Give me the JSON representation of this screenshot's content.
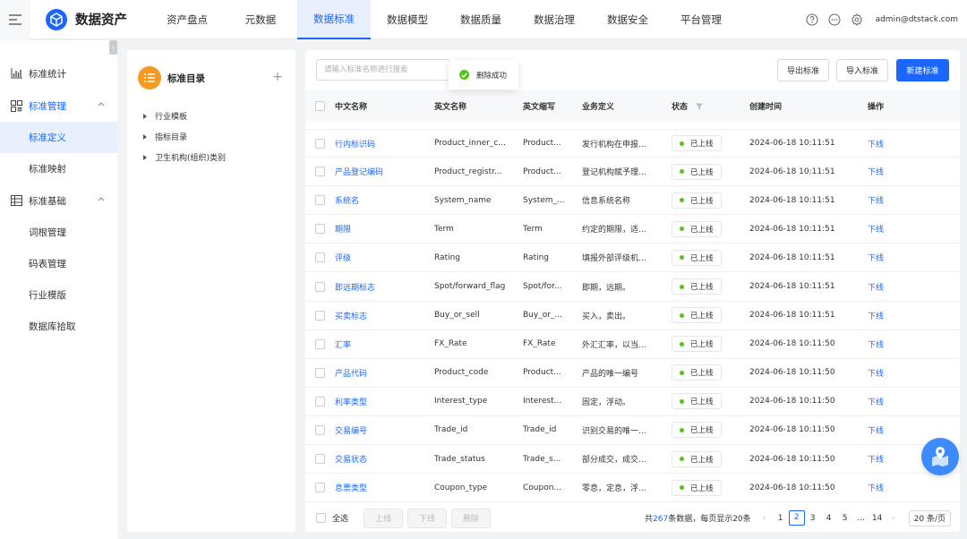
{
  "app": {
    "title": "数据资产"
  },
  "nav": {
    "items": [
      {
        "label": "资产盘点",
        "active": false
      },
      {
        "label": "元数据",
        "active": false
      },
      {
        "label": "数据标准",
        "active": true
      },
      {
        "label": "数据模型",
        "active": false
      },
      {
        "label": "数据质量",
        "active": false
      },
      {
        "label": "数据治理",
        "active": false
      },
      {
        "label": "数据安全",
        "active": false
      },
      {
        "label": "平台管理",
        "active": false
      }
    ],
    "user": "admin@dtstack.com",
    "icons": [
      "help-icon",
      "message-icon",
      "settings-icon"
    ]
  },
  "sidebar": {
    "groups": [
      {
        "label": "标准统计",
        "icon": "chart-icon",
        "items": []
      },
      {
        "label": "标准管理",
        "icon": "manage-icon",
        "open": true,
        "items": [
          {
            "label": "标准定义",
            "active": true
          },
          {
            "label": "标准映射",
            "active": false
          }
        ]
      },
      {
        "label": "标准基础",
        "icon": "table-icon",
        "open": true,
        "items": [
          {
            "label": "词根管理",
            "active": false
          },
          {
            "label": "码表管理",
            "active": false
          },
          {
            "label": "行业模版",
            "active": false
          },
          {
            "label": "数据库拾取",
            "active": false
          }
        ]
      }
    ]
  },
  "directory": {
    "title": "标准目录",
    "nodes": [
      "行业模板",
      "指标目录",
      "卫生机构(组织)类别"
    ]
  },
  "toolbar": {
    "search_placeholder": "请输入标准名称进行搜索",
    "export_label": "导出标准",
    "import_label": "导入标准",
    "new_label": "新建标准"
  },
  "toast": {
    "message": "删除成功"
  },
  "table": {
    "headers": {
      "cn": "中文名称",
      "en": "英文名称",
      "abbr": "英文缩写",
      "def": "业务定义",
      "status": "状态",
      "time": "创建时间",
      "op": "操作"
    },
    "rows": [
      {
        "cn": "行内标识码",
        "en": "Product_inner_c...",
        "abbr": "Product...",
        "def": "发行机构在申报...",
        "status": "已上线",
        "time": "2024-06-18 10:11:51",
        "op": "下线"
      },
      {
        "cn": "产品登记编码",
        "en": "Product_registr...",
        "abbr": "Product...",
        "def": "登记机构赋予理...",
        "status": "已上线",
        "time": "2024-06-18 10:11:51",
        "op": "下线"
      },
      {
        "cn": "系统名",
        "en": "System_name",
        "abbr": "System_...",
        "def": "信息系统名称",
        "status": "已上线",
        "time": "2024-06-18 10:11:51",
        "op": "下线"
      },
      {
        "cn": "期限",
        "en": "Term",
        "abbr": "Term",
        "def": "约定的期限，适...",
        "status": "已上线",
        "time": "2024-06-18 10:11:51",
        "op": "下线"
      },
      {
        "cn": "评级",
        "en": "Rating",
        "abbr": "Rating",
        "def": "填报外部评级机...",
        "status": "已上线",
        "time": "2024-06-18 10:11:51",
        "op": "下线"
      },
      {
        "cn": "即远期标志",
        "en": "Spot/forward_flag",
        "abbr": "Spot/for...",
        "def": "即期，远期。",
        "status": "已上线",
        "time": "2024-06-18 10:11:51",
        "op": "下线"
      },
      {
        "cn": "买卖标志",
        "en": "Buy_or_sell",
        "abbr": "Buy_or_...",
        "def": "买入，卖出。",
        "status": "已上线",
        "time": "2024-06-18 10:11:51",
        "op": "下线"
      },
      {
        "cn": "汇率",
        "en": "FX_Rate",
        "abbr": "FX_Rate",
        "def": "外汇汇率，以当...",
        "status": "已上线",
        "time": "2024-06-18 10:11:50",
        "op": "下线"
      },
      {
        "cn": "产品代码",
        "en": "Product_code",
        "abbr": "Product...",
        "def": "产品的唯一编号",
        "status": "已上线",
        "time": "2024-06-18 10:11:50",
        "op": "下线"
      },
      {
        "cn": "利率类型",
        "en": "Interest_type",
        "abbr": "Interest...",
        "def": "固定，浮动。",
        "status": "已上线",
        "time": "2024-06-18 10:11:50",
        "op": "下线"
      },
      {
        "cn": "交易编号",
        "en": "Trade_id",
        "abbr": "Trade_id",
        "def": "识别交易的唯一...",
        "status": "已上线",
        "time": "2024-06-18 10:11:50",
        "op": "下线"
      },
      {
        "cn": "交易状态",
        "en": "Trade_status",
        "abbr": "Trade_s...",
        "def": "部分成交，成交...",
        "status": "已上线",
        "time": "2024-06-18 10:11:50",
        "op": "下线"
      },
      {
        "cn": "息票类型",
        "en": "Coupon_type",
        "abbr": "Coupon...",
        "def": "零息，定息，浮...",
        "status": "已上线",
        "time": "2024-06-18 10:11:50",
        "op": "下线"
      }
    ]
  },
  "footer": {
    "select_all": "全选",
    "online_label": "上线",
    "offline_label": "下线",
    "delete_label": "删除",
    "total_prefix": "共",
    "total": "267",
    "total_suffix": "条数据，每页显示20条",
    "pages": [
      "1",
      "2",
      "3",
      "4",
      "5",
      "...",
      "14"
    ],
    "current_page": "2",
    "page_size": "20 条/页"
  },
  "colors": {
    "primary": "#1a66ff",
    "success": "#52c41a",
    "badge": "#f59a23"
  }
}
